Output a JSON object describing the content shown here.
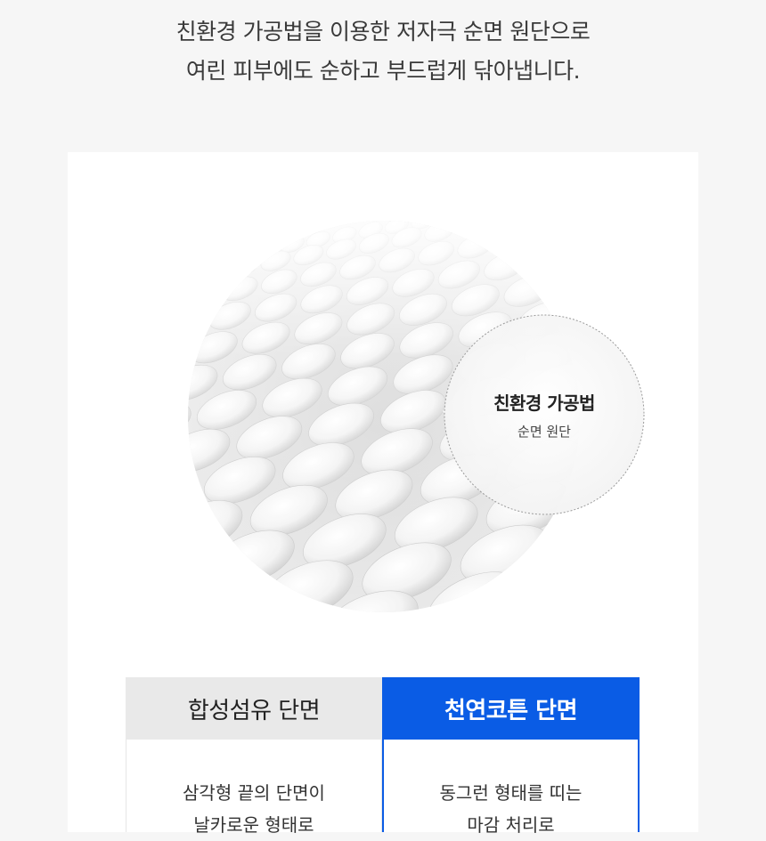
{
  "intro": {
    "line1": "친환경 가공법을 이용한 저자극 순면 원단으로",
    "line2": "여린 피부에도 순하고 부드럽게 닦아냅니다."
  },
  "badge": {
    "title": "친환경 가공법",
    "subtitle": "순면 원단"
  },
  "comparison": {
    "synthetic": {
      "header": "합성섬유 단면",
      "line1": "삼각형 끝의 단면이",
      "line2": "날카로운 형태로"
    },
    "cotton": {
      "header": "천연코튼 단면",
      "line1": "동그런 형태를 띠는",
      "line2": "마감 처리로"
    }
  },
  "colors": {
    "accent": "#0a5ce5",
    "header_gray": "#e9e9e9",
    "background": "#f6f6f6",
    "card": "#ffffff"
  },
  "icons": {
    "fabric_image": "knitted-fabric-closeup-image",
    "badge_shape": "dotted-circle-callout"
  }
}
